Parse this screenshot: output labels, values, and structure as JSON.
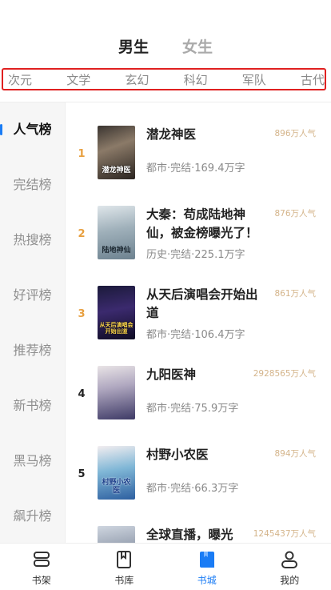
{
  "gender_tabs": [
    {
      "label": "男生",
      "active": true
    },
    {
      "label": "女生",
      "active": false
    }
  ],
  "categories": [
    "次元",
    "文学",
    "玄幻",
    "科幻",
    "军队",
    "古代"
  ],
  "left_nav": [
    {
      "label": "人气榜",
      "active": true
    },
    {
      "label": "完结榜",
      "active": false
    },
    {
      "label": "热搜榜",
      "active": false
    },
    {
      "label": "好评榜",
      "active": false
    },
    {
      "label": "推荐榜",
      "active": false
    },
    {
      "label": "新书榜",
      "active": false
    },
    {
      "label": "黑马榜",
      "active": false
    },
    {
      "label": "飙升榜",
      "active": false
    }
  ],
  "books": [
    {
      "rank": "1",
      "title_line1": "潜龙神医",
      "title_line2": "",
      "meta": "都市·完结·169.4万字",
      "popularity": "896万人气",
      "cover_text": "潜龙神医"
    },
    {
      "rank": "2",
      "title_line1": "大秦：苟成陆地神",
      "title_line2": "仙，被金榜曝光了！",
      "meta": "历史·完结·225.1万字",
      "popularity": "876万人气",
      "cover_text": "陆地神仙"
    },
    {
      "rank": "3",
      "title_line1": "从天后演唱会开始出",
      "title_line2": "道",
      "meta": "都市·完结·106.4万字",
      "popularity": "861万人气",
      "cover_text": "从天后演唱会开始出道"
    },
    {
      "rank": "4",
      "title_line1": "九阳医神",
      "title_line2": "",
      "meta": "都市·完结·75.9万字",
      "popularity": "2928565万人气",
      "cover_text": ""
    },
    {
      "rank": "5",
      "title_line1": "村野小农医",
      "title_line2": "",
      "meta": "都市·完结·66.3万字",
      "popularity": "894万人气",
      "cover_text": "村野小农医"
    },
    {
      "rank": "",
      "title_line1": "全球直播，曝光",
      "title_line2": "",
      "meta": "",
      "popularity": "1245437万人气",
      "cover_text": ""
    }
  ],
  "bottom_bar": [
    {
      "label": "书架",
      "icon": "bookshelf-icon",
      "active": false
    },
    {
      "label": "书库",
      "icon": "library-icon",
      "active": false
    },
    {
      "label": "书城",
      "icon": "bookstore-icon",
      "active": true
    },
    {
      "label": "我的",
      "icon": "profile-icon",
      "active": false
    }
  ],
  "colors": {
    "accent": "#1a7cf5",
    "rank_top": "#e8a040",
    "popularity": "#d4b48a",
    "highlight_border": "#e02020"
  }
}
